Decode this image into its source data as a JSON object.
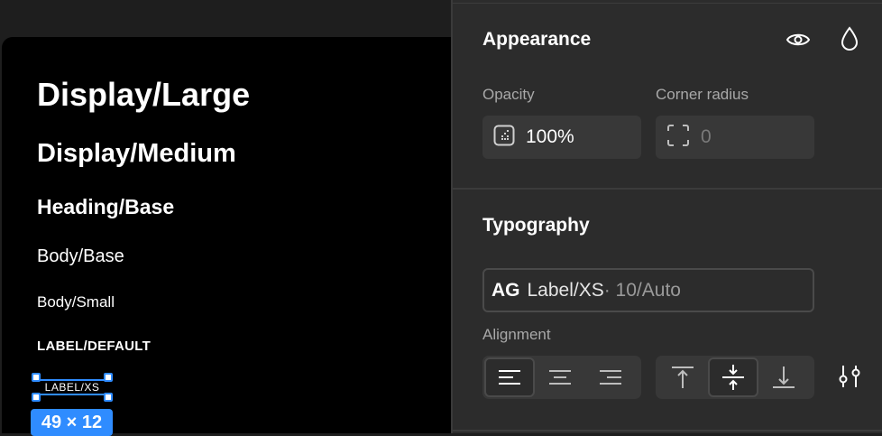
{
  "canvas": {
    "text_styles": [
      "Display/Large",
      "Display/Medium",
      "Heading/Base",
      "Body/Base",
      "Body/Small",
      "LABEL/DEFAULT"
    ],
    "selected_layer_text": "LABEL/XS",
    "dimensions_badge": "49 × 12"
  },
  "appearance": {
    "title": "Appearance",
    "opacity_label": "Opacity",
    "opacity_value": "100%",
    "corner_radius_label": "Corner radius",
    "corner_radius_value": "0"
  },
  "typography": {
    "title": "Typography",
    "font_prefix": "AG",
    "font_name": "Label/XS",
    "font_meta": "· 10/Auto",
    "alignment_label": "Alignment",
    "horizontal_alignment": [
      "align-left",
      "align-center",
      "align-right"
    ],
    "selected_horizontal": "align-left",
    "vertical_alignment": [
      "align-top",
      "align-middle",
      "align-bottom"
    ],
    "selected_vertical": "align-middle"
  },
  "colors": {
    "accent": "#2f8cff",
    "panel_bg": "#2c2c2c",
    "canvas_bg": "#000000"
  }
}
